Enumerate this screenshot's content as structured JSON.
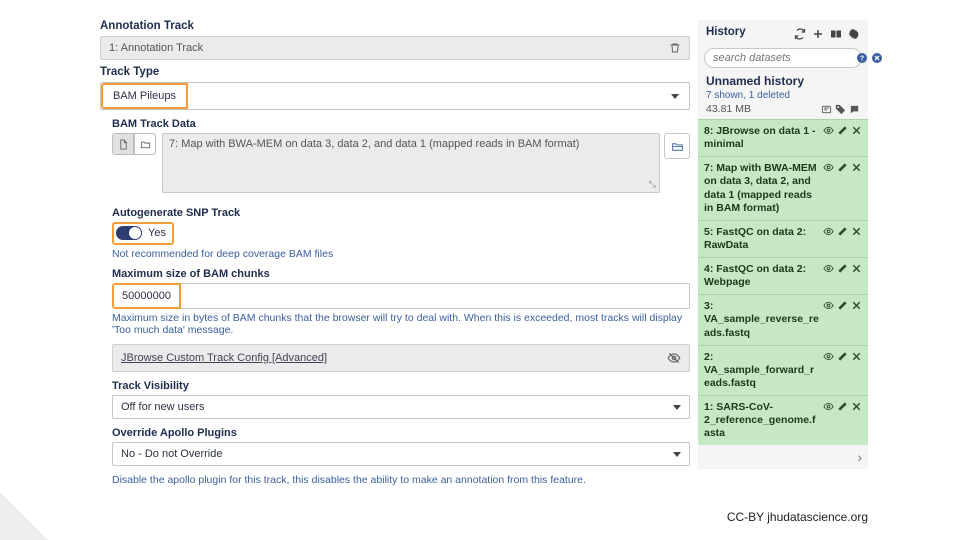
{
  "main": {
    "anno_title": "Annotation Track",
    "anno_row": "1: Annotation Track",
    "track_type_label": "Track Type",
    "track_type_value": "BAM Pileups",
    "bam_data_label": "BAM Track Data",
    "bam_data_value": "7: Map with BWA-MEM on data 3, data 2, and data 1 (mapped reads in BAM format)",
    "snp_label": "Autogenerate SNP Track",
    "snp_value": "Yes",
    "snp_help": "Not recommended for deep coverage BAM files",
    "max_chunks_label": "Maximum size of BAM chunks",
    "max_chunks_value": "50000000",
    "max_chunks_help": "Maximum size in bytes of BAM chunks that the browser will try to deal with. When this is exceeded, most tracks will display 'Too much data' message.",
    "advanced_label": "JBrowse Custom Track Config [Advanced]",
    "visibility_label": "Track Visibility",
    "visibility_value": "Off for new users",
    "apollo_label": "Override Apollo Plugins",
    "apollo_value": "No - Do not Override",
    "apollo_help": "Disable the apollo plugin for this track, this disables the ability to make an annotation from this feature."
  },
  "history": {
    "title": "History",
    "search_placeholder": "search datasets",
    "name": "Unnamed history",
    "counts": "7 shown, 1 deleted",
    "size": "43.81 MB",
    "items": [
      {
        "label": "8: JBrowse on data 1 - minimal"
      },
      {
        "label": "7: Map with BWA-MEM on data 3, data 2, and data 1 (mapped reads in BAM format)"
      },
      {
        "label": "5: FastQC on data 2: RawData"
      },
      {
        "label": "4: FastQC on data 2: Webpage"
      },
      {
        "label": "3: VA_sample_reverse_reads.fastq"
      },
      {
        "label": "2: VA_sample_forward_reads.fastq"
      },
      {
        "label": "1: SARS-CoV-2_reference_genome.fasta"
      }
    ]
  },
  "attribution": "CC-BY  jhudatascience.org"
}
